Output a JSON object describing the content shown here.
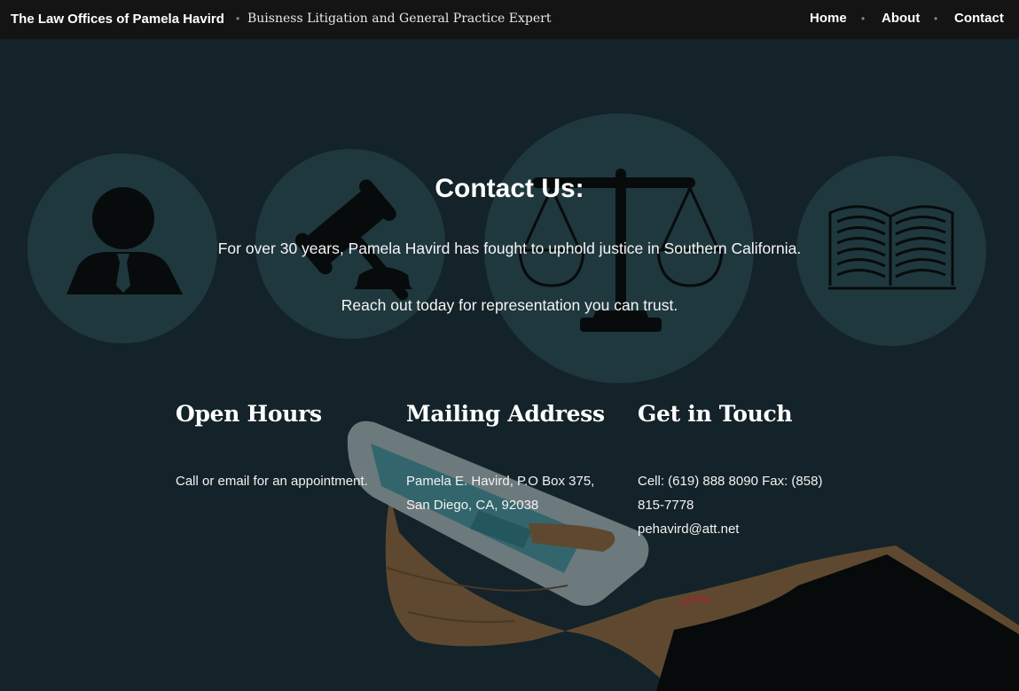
{
  "header": {
    "site_title": "The Law Offices of Pamela Havird",
    "tagline": "Buisness Litigation and General Practice Expert",
    "nav": [
      {
        "label": "Home"
      },
      {
        "label": "About"
      },
      {
        "label": "Contact"
      }
    ]
  },
  "hero": {
    "title": "Contact Us:",
    "line1": "For over 30 years, Pamela Havird has fought to uphold justice in Southern California.",
    "line2": "Reach out today for representation you can trust."
  },
  "columns": {
    "hours": {
      "title": "Open Hours",
      "text": "Call or email for an appointment."
    },
    "address": {
      "title": "Mailing Address",
      "line1": "Pamela E. Havird, P.O Box 375,",
      "line2": "San Diego, CA, 92038"
    },
    "contact": {
      "title": "Get in Touch",
      "line1": "Cell: (619) 888 8090 Fax: (858)",
      "line2": "815-7778",
      "email": "pehavird@att.net"
    }
  },
  "colors": {
    "background": "#17262d",
    "topbar": "#141414",
    "circle": "#264248",
    "skin": "#7a5936",
    "phone": "#8d9a9c",
    "screen": "#3f7f86"
  },
  "icons": [
    "person-icon",
    "gavel-icon",
    "scales-icon",
    "book-icon",
    "hand-phone-illustration"
  ]
}
